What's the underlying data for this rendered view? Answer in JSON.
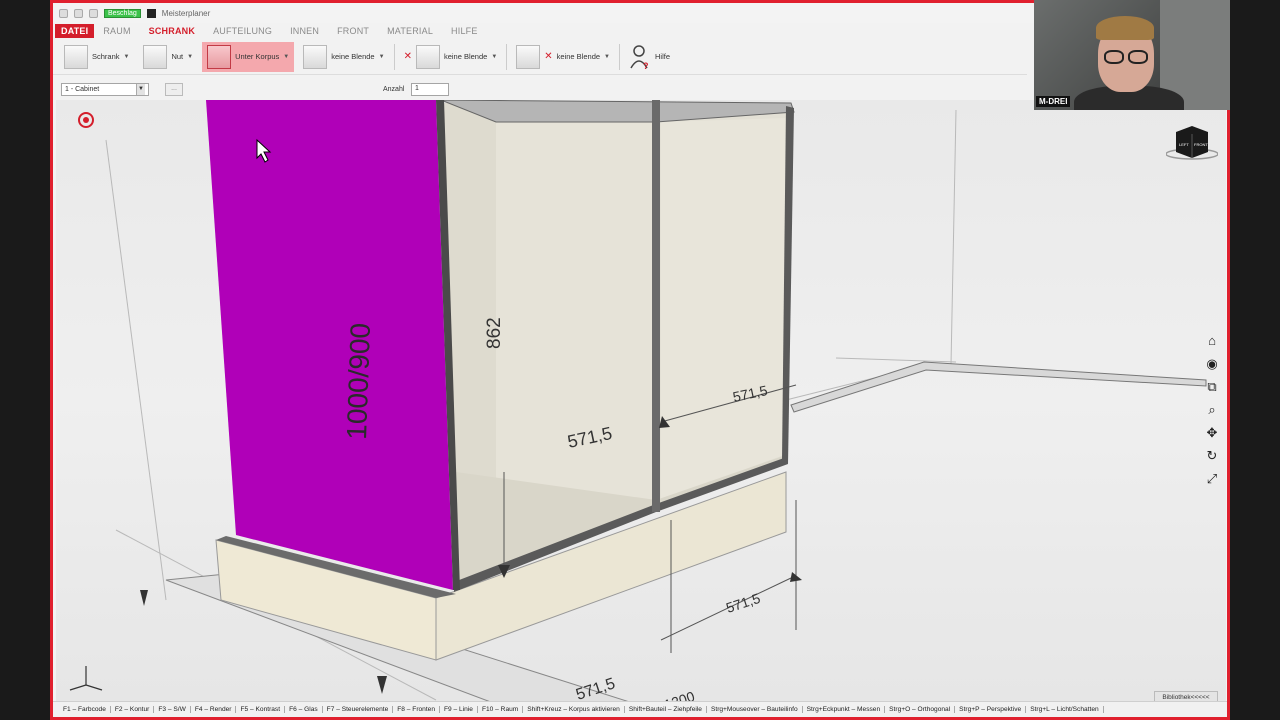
{
  "titlebar": {
    "tag": "Beschlag",
    "app_title": "Meisterplaner"
  },
  "menu": {
    "tabs": [
      "DATEI",
      "RAUM",
      "SCHRANK",
      "AUFTEILUNG",
      "INNEN",
      "FRONT",
      "MATERIAL",
      "HILFE"
    ],
    "active": "SCHRANK"
  },
  "ribbon": {
    "schrank": "Schrank",
    "nut": "Nut",
    "unter_korpus": "Unter Korpus",
    "blende1": "keine Blende",
    "blende2": "keine Blende",
    "blende3": "keine Blende",
    "hilfe": "Hilfe"
  },
  "props": {
    "cabinet_value": "1 - Cabinet",
    "more": "...",
    "anzahl_label": "Anzahl",
    "anzahl_value": "1"
  },
  "scene": {
    "dim_side": "1000/900",
    "dim_height": "862",
    "dim_depth_left": "571,5",
    "dim_depth_right": "571,5",
    "dim_bottom_right": "571,5",
    "dim_bottom_a": "571,5",
    "dim_bottom_b": "1200",
    "side_panel_color": "#b000b8",
    "accent": "#d41e2b"
  },
  "viewcube": {
    "left": "LEFT",
    "front": "FRONT"
  },
  "bibliothek": "Bibliothek<<<<<",
  "statusbar": [
    "F1 – Farbcode",
    "F2 – Kontur",
    "F3 – S/W",
    "F4 – Render",
    "F5 – Kontrast",
    "F6 – Glas",
    "F7 – Steuerelemente",
    "F8 – Fronten",
    "F9 – Linie",
    "F10 – Raum",
    "Shift+Kreuz – Korpus aktivieren",
    "Shift+Bauteil – Ziehpfeile",
    "Strg+Mouseover – Bauteilinfo",
    "Strg+Eckpunkt – Messen",
    "Strg+O – Orthogonal",
    "Strg+P – Perspektive",
    "Strg+L – Licht/Schatten"
  ],
  "webcam": {
    "label": "M-DREI"
  }
}
